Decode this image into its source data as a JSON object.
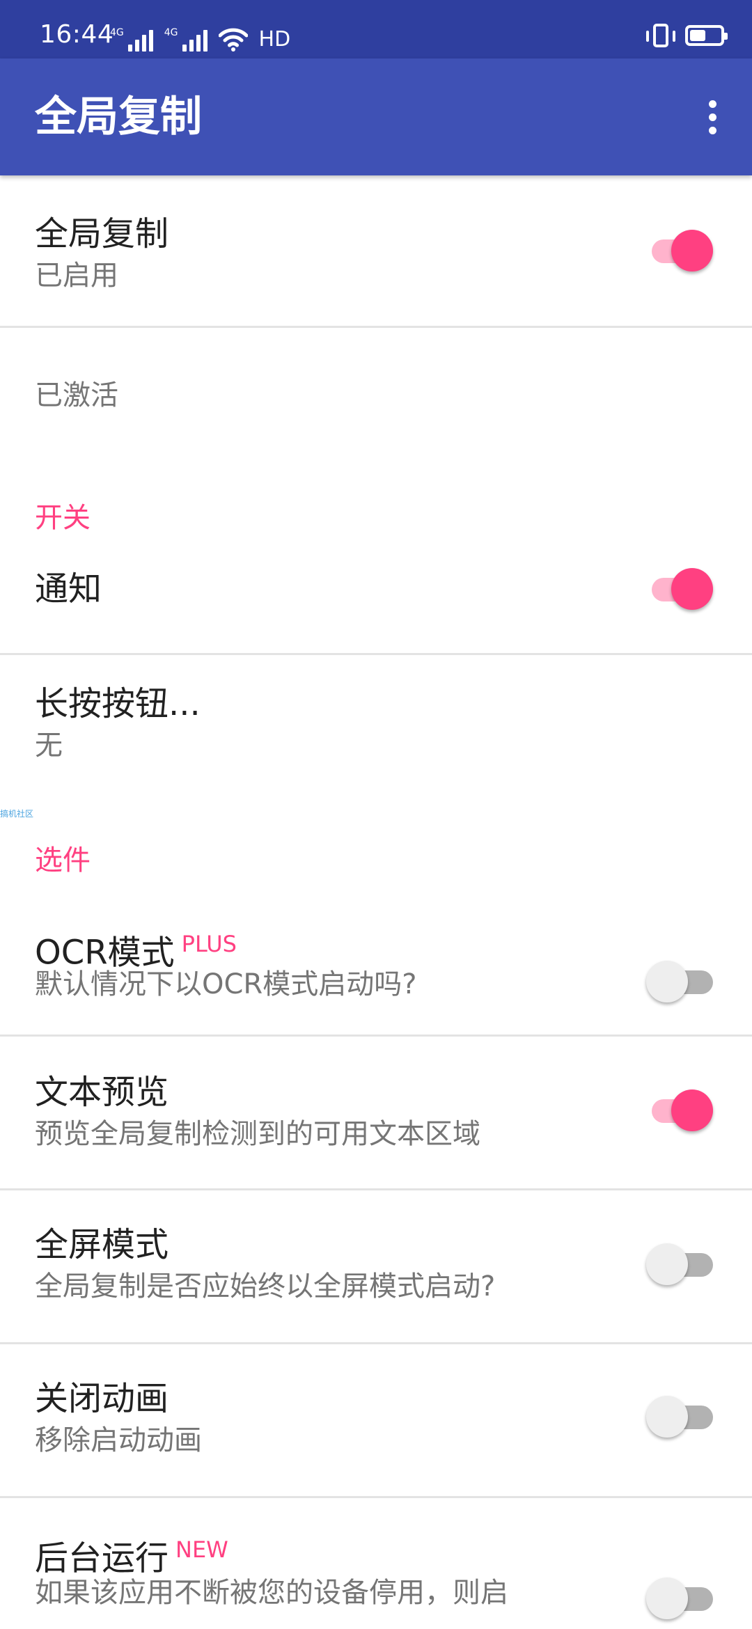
{
  "status_bar": {
    "time": "16:44",
    "signal_1_tag": "4G",
    "signal_2_tag": "4G",
    "hd_label": "HD"
  },
  "app_bar": {
    "title": "全局复制"
  },
  "prefs": {
    "global_copy": {
      "title": "全局复制",
      "summary": "已启用",
      "enabled": true
    },
    "activated_text": "已激活",
    "category_switch": "开关",
    "notification": {
      "title": "通知",
      "enabled": true
    },
    "long_press": {
      "title": "长按按钮...",
      "summary": "无"
    },
    "watermark": "搞机社区",
    "category_options": "选件",
    "ocr_mode": {
      "title": "OCR模式",
      "badge": "PLUS",
      "summary": "默认情况下以OCR模式启动吗?",
      "enabled": false
    },
    "text_preview": {
      "title": "文本预览",
      "summary": "预览全局复制检测到的可用文本区域",
      "enabled": true
    },
    "fullscreen_mode": {
      "title": "全屏模式",
      "summary": "全局复制是否应始终以全屏模式启动?",
      "enabled": false
    },
    "disable_animation": {
      "title": "关闭动画",
      "summary": "移除启动动画",
      "enabled": false
    },
    "background_run": {
      "title": "后台运行",
      "badge": "NEW",
      "summary": "如果该应用不断被您的设备停用，则启",
      "enabled": false
    }
  },
  "colors": {
    "status_bar": "#2f3f9f",
    "app_bar": "#3f51b5",
    "accent": "#ff4081"
  }
}
